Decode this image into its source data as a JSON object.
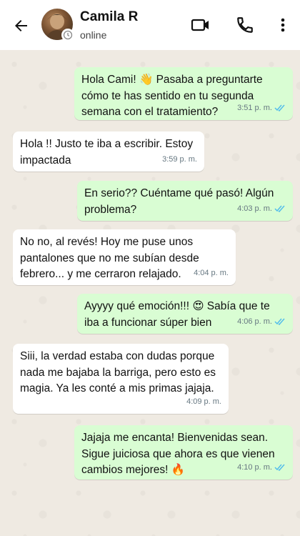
{
  "header": {
    "contact_name": "Camila R",
    "status": "online"
  },
  "colors": {
    "outgoing_bubble": "#d9fdd3",
    "incoming_bubble": "#ffffff",
    "read_ticks": "#53bdeb",
    "chat_background": "#efeae2"
  },
  "messages": [
    {
      "direction": "out",
      "text": "Hola Cami! 👋 Pasaba a preguntarte cómo te has sentido en tu segunda semana con el tratamiento?",
      "time": "3:51 p. m.",
      "read": true
    },
    {
      "direction": "in",
      "text": "Hola !! Justo te iba a escribir. Estoy impactada",
      "time": "3:59 p. m."
    },
    {
      "direction": "out",
      "text": "En serio?? Cuéntame qué pasó! Algún problema?",
      "time": "4:03 p. m.",
      "read": true
    },
    {
      "direction": "in",
      "text": "No no, al revés! Hoy me puse unos pantalones que no me subían desde febrero... y me cerraron relajado.",
      "time": "4:04 p. m."
    },
    {
      "direction": "out",
      "text": "Ayyyy qué emoción!!! 😍 Sabía que te iba a funcionar súper bien",
      "time": "4:06 p. m.",
      "read": true
    },
    {
      "direction": "in",
      "text": "Siii, la verdad estaba con dudas porque nada me bajaba la barriga, pero esto es magia. Ya les conté a mis primas jajaja.",
      "time": "4:09 p. m."
    },
    {
      "direction": "out",
      "text": "Jajaja me encanta! Bienvenidas sean. Sigue juiciosa que ahora es que vienen cambios mejores! 🔥",
      "time": "4:10 p. m.",
      "read": true
    }
  ]
}
